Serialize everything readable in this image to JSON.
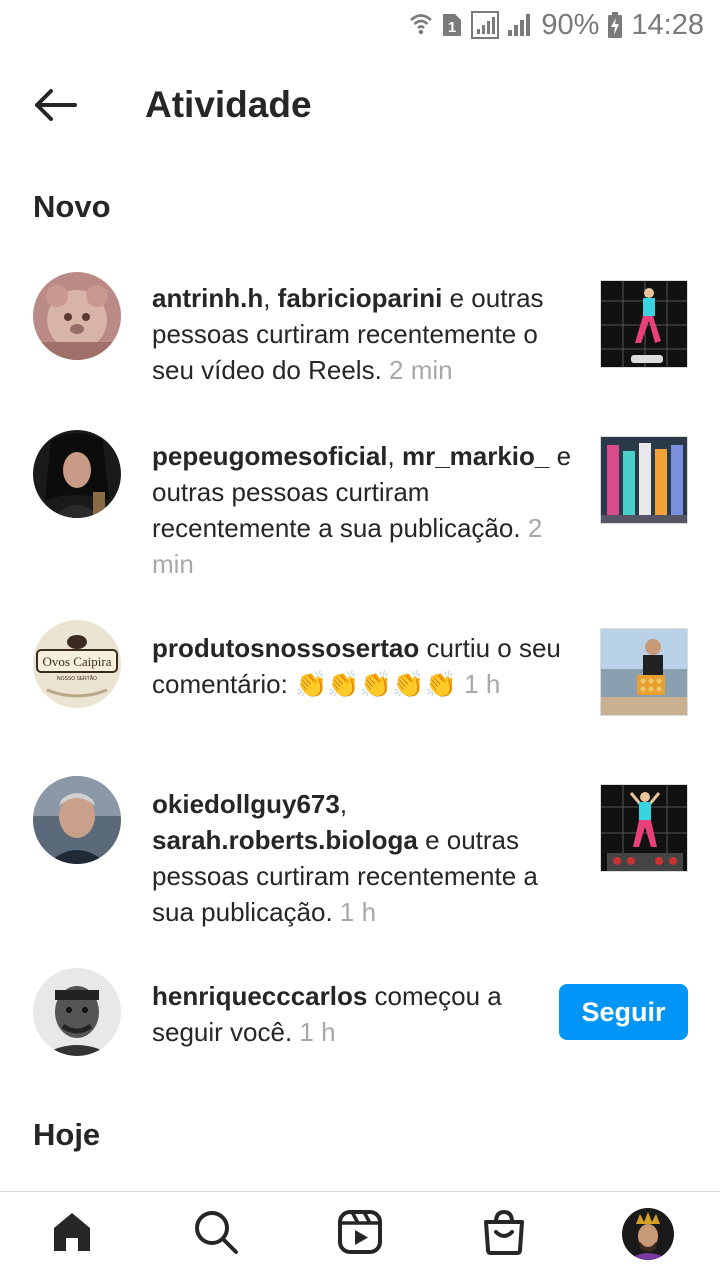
{
  "status_bar": {
    "battery": "90%",
    "time": "14:28",
    "sim_label": "1",
    "icons": [
      "wifi-icon",
      "sim-icon",
      "signal-icon",
      "signal-icon",
      "battery-charging-icon"
    ]
  },
  "header": {
    "title": "Atividade",
    "back_icon": "arrow-left-icon"
  },
  "sections": {
    "new": "Novo",
    "today": "Hoje"
  },
  "notifications": [
    {
      "users": [
        "antrinh.h",
        "fabricioparini"
      ],
      "separator": ", ",
      "text": " e outras pessoas curtiram recentemente o seu vídeo do Reels.",
      "time": "2 min"
    },
    {
      "users": [
        "pepeugomesoficial",
        "mr_markio_"
      ],
      "separator": ", ",
      "text": " e outras pessoas curtiram recentemente a sua publicação.",
      "time": "2 min"
    },
    {
      "users": [
        "produtosnossosertao"
      ],
      "separator": "",
      "text": " curtiu o seu comentário: 👏👏👏👏👏",
      "time": "1 h",
      "avatar_text_1": "Ovos Caipira",
      "avatar_text_2": "NOSSO SERTÃO"
    },
    {
      "users": [
        "okiedollguy673",
        "sarah.roberts.biologa"
      ],
      "separator": ", ",
      "text": " e outras pessoas curtiram recentemente a sua publicação.",
      "time": "1 h"
    },
    {
      "users": [
        "henriquecccarlos"
      ],
      "separator": "",
      "text": " começou a seguir você.",
      "time": "1 h",
      "button": "Seguir"
    }
  ],
  "colors": {
    "accent": "#0095f6",
    "text": "#262626",
    "muted": "#a8a8a8",
    "divider": "#dbdbdb"
  },
  "bottom_nav": [
    "home-icon",
    "search-icon",
    "reels-icon",
    "shop-icon",
    "profile-avatar"
  ]
}
